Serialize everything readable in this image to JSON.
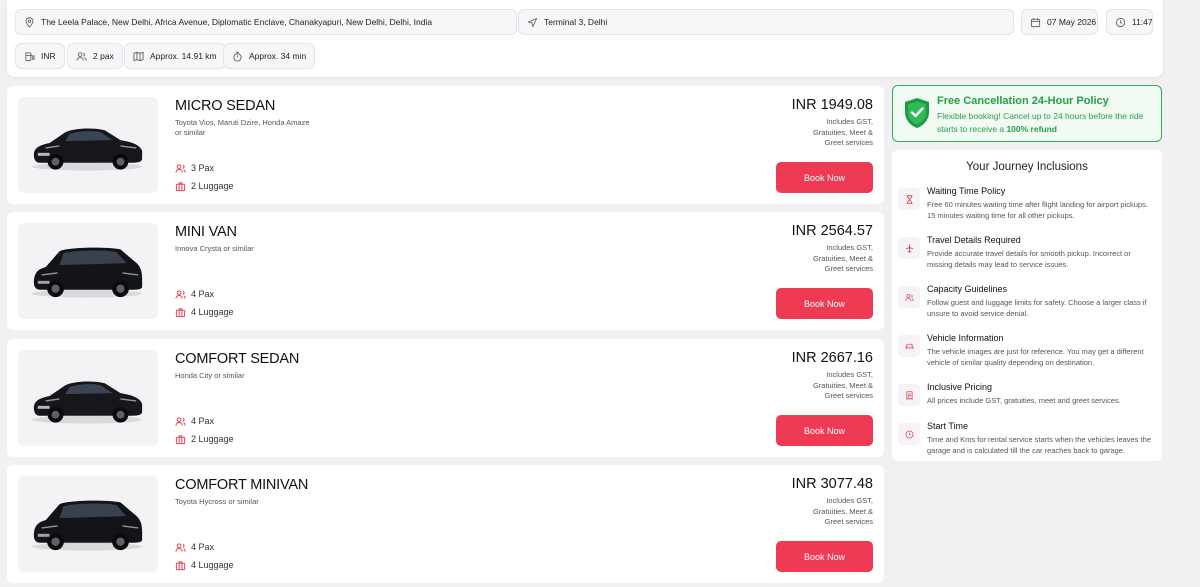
{
  "search": {
    "pickup": "The Leela Palace, New Delhi, Africa Avenue, Diplomatic Enclave, Chanakyapuri, New Delhi, Delhi, India",
    "dropoff": "Terminal 3, Delhi",
    "date": "07 May 2026",
    "time": "11:47",
    "currency": "INR",
    "pax": "2 pax",
    "distance": "Approx. 14.91 km",
    "duration": "Approx. 34 min"
  },
  "accent_color": "#ef3a53",
  "book_label": "Book Now",
  "includes_text": "Includes GST, Gratuities, Meet & Greet services",
  "cars": [
    {
      "name": "MICRO SEDAN",
      "models": "Toyota Vios, Maruti Dzire, Honda Amaze or similar",
      "pax": "3 Pax",
      "luggage": "2 Luggage",
      "price": "INR 1949.08"
    },
    {
      "name": "MINI VAN",
      "models": "Innova Crysta or similar",
      "pax": "4 Pax",
      "luggage": "4 Luggage",
      "price": "INR 2564.57"
    },
    {
      "name": "COMFORT SEDAN",
      "models": "Honda City or similar",
      "pax": "4 Pax",
      "luggage": "2 Luggage",
      "price": "INR 2667.16"
    },
    {
      "name": "COMFORT MINIVAN",
      "models": "Toyota Hycross or similar",
      "pax": "4 Pax",
      "luggage": "4 Luggage",
      "price": "INR 3077.48"
    }
  ],
  "cancellation": {
    "title": "Free Cancellation 24-Hour Policy",
    "text_before": "Flexible booking! Cancel up to 24 hours before the ride starts to receive a ",
    "text_bold": "100% refund"
  },
  "inclusions": {
    "title": "Your Journey Inclusions",
    "items": [
      {
        "icon": "hourglass-icon",
        "title": "Waiting Time Policy",
        "text": "Free 60 minutes waiting time after flight landing for airport pickups. 15 minutes waiting time for all other pickups."
      },
      {
        "icon": "plane-icon",
        "title": "Travel Details Required",
        "text": "Provide accurate travel details for smooth pickup. Incorrect or missing details may lead to service issues."
      },
      {
        "icon": "users-icon",
        "title": "Capacity Guidelines",
        "text": "Follow guest and luggage limits for safety. Choose a larger class if unsure to avoid service denial."
      },
      {
        "icon": "car-icon",
        "title": "Vehicle Information",
        "text": "The vehicle images are just for reference. You may get a different vehicle of similar quality depending on destination."
      },
      {
        "icon": "receipt-icon",
        "title": "Inclusive Pricing",
        "text": "All prices include GST, gratuities, meet and greet services."
      },
      {
        "icon": "clock-icon",
        "title": "Start Time",
        "text": "Time and Kms for rental service starts when the vehicles leaves the garage and is calculated till the car reaches back to garage."
      }
    ]
  }
}
